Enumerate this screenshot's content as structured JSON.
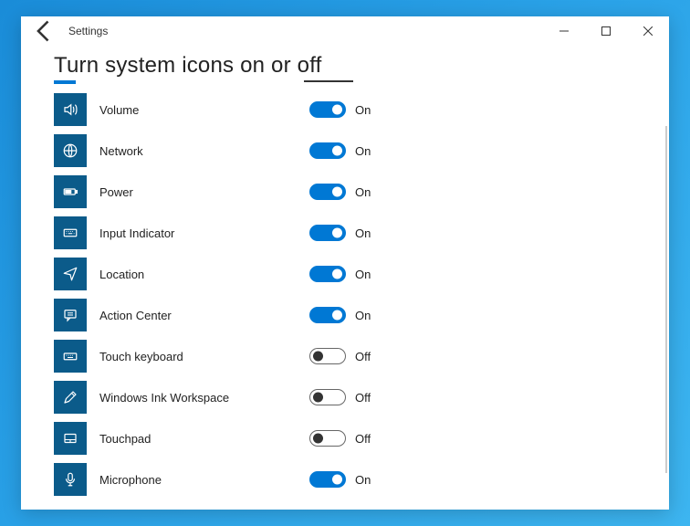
{
  "app": {
    "title": "Settings"
  },
  "page": {
    "title": "Turn system icons on or off"
  },
  "labels": {
    "on": "On",
    "off": "Off"
  },
  "colors": {
    "accent": "#0078d4",
    "iconBox": "#0b5b8a"
  },
  "items": [
    {
      "id": "volume",
      "label": "Volume",
      "icon": "volume-icon",
      "state": "on"
    },
    {
      "id": "network",
      "label": "Network",
      "icon": "globe-icon",
      "state": "on"
    },
    {
      "id": "power",
      "label": "Power",
      "icon": "battery-icon",
      "state": "on"
    },
    {
      "id": "inputindicator",
      "label": "Input Indicator",
      "icon": "keyboard-icon",
      "state": "on"
    },
    {
      "id": "location",
      "label": "Location",
      "icon": "location-icon",
      "state": "on"
    },
    {
      "id": "actioncenter",
      "label": "Action Center",
      "icon": "message-icon",
      "state": "on"
    },
    {
      "id": "touchkeyboard",
      "label": "Touch keyboard",
      "icon": "touchkbd-icon",
      "state": "off"
    },
    {
      "id": "winink",
      "label": "Windows Ink Workspace",
      "icon": "pen-icon",
      "state": "off"
    },
    {
      "id": "touchpad",
      "label": "Touchpad",
      "icon": "touchpad-icon",
      "state": "off"
    },
    {
      "id": "microphone",
      "label": "Microphone",
      "icon": "mic-icon",
      "state": "on"
    }
  ]
}
